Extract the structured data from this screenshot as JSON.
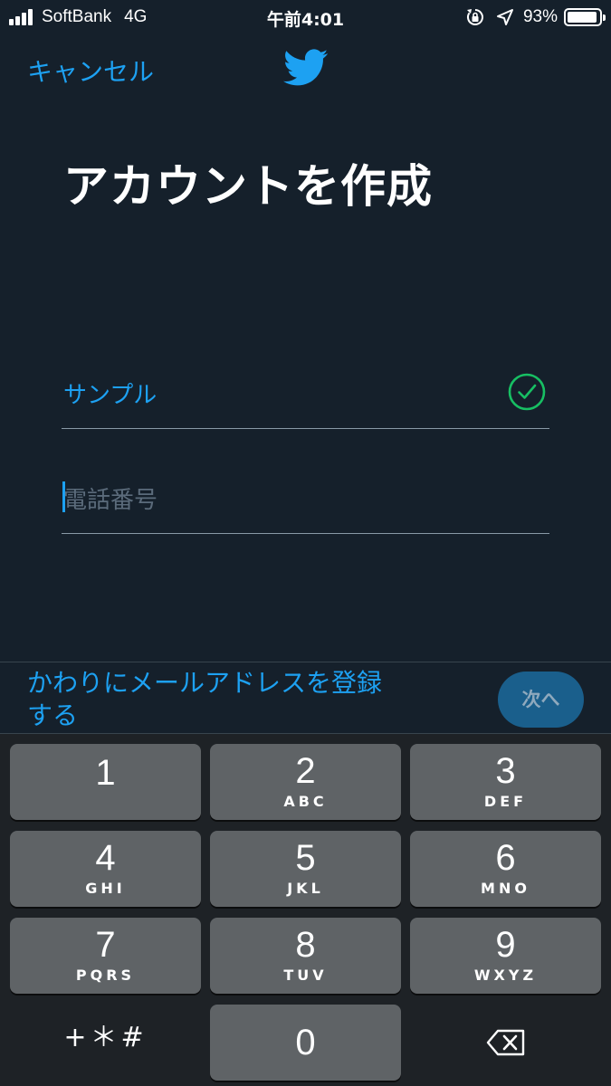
{
  "status": {
    "carrier": "SoftBank",
    "network": "4G",
    "time": "午前4:01",
    "battery": "93%",
    "battery_level": 0.93
  },
  "header": {
    "cancel_label": "キャンセル",
    "logo": "twitter-bird-icon",
    "brand_color": "#1da1f2"
  },
  "main": {
    "title": "アカウントを作成",
    "name_value": "サンプル",
    "name_valid": true,
    "phone_placeholder": "電話番号"
  },
  "footer": {
    "alt_link": "かわりにメールアドレスを登録する",
    "next_label": "次へ"
  },
  "keypad": {
    "keys": [
      {
        "digit": "1",
        "letters": ""
      },
      {
        "digit": "2",
        "letters": "ABC"
      },
      {
        "digit": "3",
        "letters": "DEF"
      },
      {
        "digit": "4",
        "letters": "GHI"
      },
      {
        "digit": "5",
        "letters": "JKL"
      },
      {
        "digit": "6",
        "letters": "MNO"
      },
      {
        "digit": "7",
        "letters": "PQRS"
      },
      {
        "digit": "8",
        "letters": "TUV"
      },
      {
        "digit": "9",
        "letters": "WXYZ"
      },
      {
        "digit": "0",
        "letters": ""
      }
    ],
    "symbols_label": "+＊#",
    "delete_icon": "backspace-icon"
  }
}
